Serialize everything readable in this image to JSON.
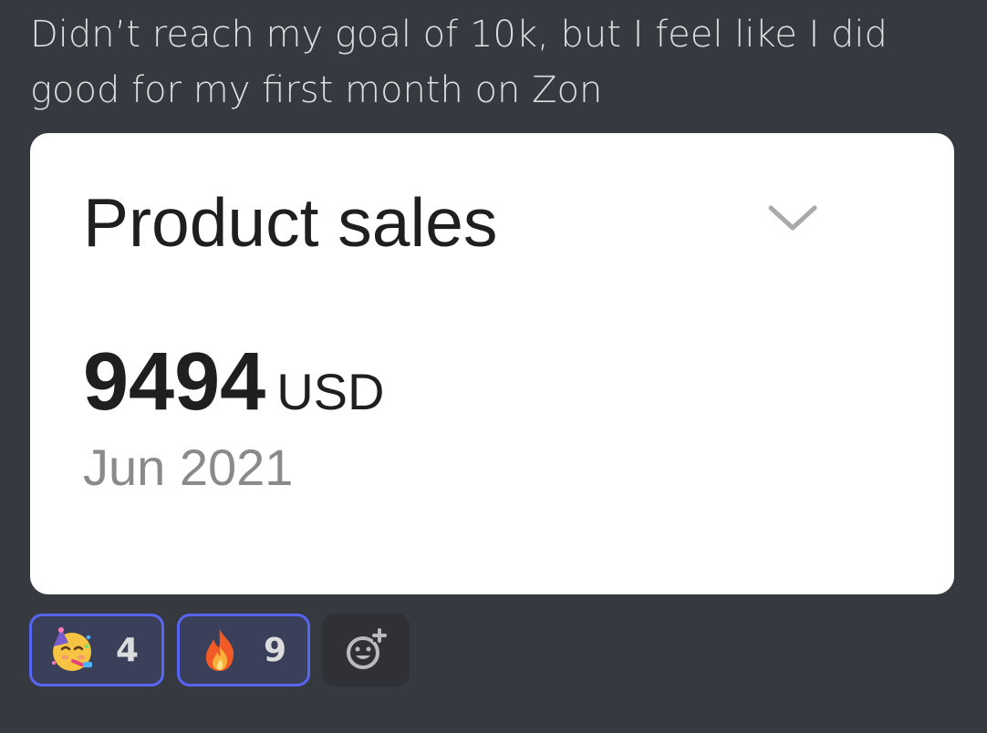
{
  "message": {
    "text": "Didn’t reach my goal of 10k, but I feel like I did good for my first month on Zon"
  },
  "card": {
    "title": "Product sales",
    "amount": "9494",
    "currency": "USD",
    "period": "Jun 2021",
    "dropdown_icon": "chevron-down-icon"
  },
  "reactions": [
    {
      "emoji": "partying-face",
      "count": "4",
      "selected": true
    },
    {
      "emoji": "fire",
      "count": "9",
      "selected": true
    }
  ],
  "add_reaction_icon": "add-reaction-icon",
  "colors": {
    "background": "#36393f",
    "reaction_border": "#5865f2",
    "reaction_bg": "#3b405a",
    "card_bg": "#ffffff"
  }
}
